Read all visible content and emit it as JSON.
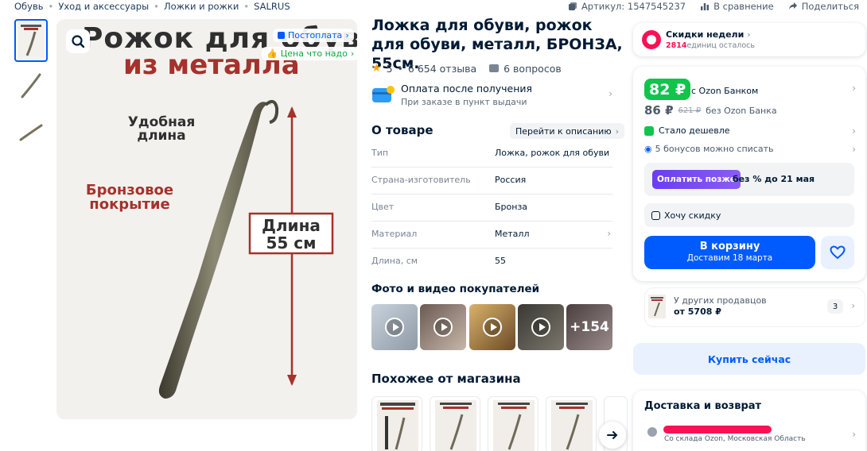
{
  "breadcrumbs": [
    "Обувь",
    "Уход и аксессуары",
    "Ложки и рожки",
    "SALRUS"
  ],
  "meta": {
    "article": "Артикул: 1547545237",
    "compare": "В сравнение",
    "share": "Поделиться"
  },
  "gallery": {
    "headline1": "Рожок для обуви",
    "headline2": "из металла",
    "label_length": "Удобная длина",
    "label_coating": "Бронзовое покрытие",
    "label_size_top": "Длина",
    "label_size_bottom": "55 см",
    "badge_regular": "Постоплата",
    "badge_price": "Цена что надо"
  },
  "product": {
    "title": "Ложка для обуви, рожок для обуви, металл, БРОНЗА, 55см.",
    "rating": "5",
    "reviews": "6 654 отзыва",
    "questions": "6 вопросов",
    "pay_title": "Оплата после получения",
    "pay_sub": "При заказе в пункт выдачи",
    "about_title": "О товаре",
    "goto_desc": "Перейти к описанию",
    "specs": [
      {
        "key": "Тип",
        "value": "Ложка, рожок для обуви"
      },
      {
        "key": "Страна-изготовитель",
        "value": "Россия"
      },
      {
        "key": "Цвет",
        "value": "Бронза"
      },
      {
        "key": "Материал",
        "value": "Металл"
      },
      {
        "key": "Длина, см",
        "value": "55"
      }
    ],
    "ugc_title": "Фото и видео покупателей",
    "ugc_more": "+154",
    "similar_title": "Похожее от магазина"
  },
  "sidebar": {
    "week_title": "Скидки недели",
    "week_count": "2814",
    "week_sub": "единиц осталось",
    "price_ozon": "82 ₽",
    "price_ozon_label": "с Ozon Банком",
    "price_regular": "86 ₽",
    "price_old": "621 ₽",
    "price_regular_label": "без Ozon Банка",
    "cheaper": "Стало дешевле",
    "bonus": "5 бонусов можно списать",
    "later_btn": "Оплатить позже",
    "later_text": "без % до 21 мая",
    "want_discount": "Хочу скидку",
    "cart_title": "В корзину",
    "cart_sub": "Доставим 18 марта",
    "other_sellers": "У других продавцов",
    "other_price": "от 5708 ₽",
    "other_count": "3",
    "buy_now": "Купить сейчас",
    "delivery_title": "Доставка и возврат",
    "delivery_from": "Со склада Ozon, Московская Область"
  },
  "colors": {
    "accent": "#005bff",
    "green": "#10c44c",
    "red_bar": "#f91155"
  }
}
